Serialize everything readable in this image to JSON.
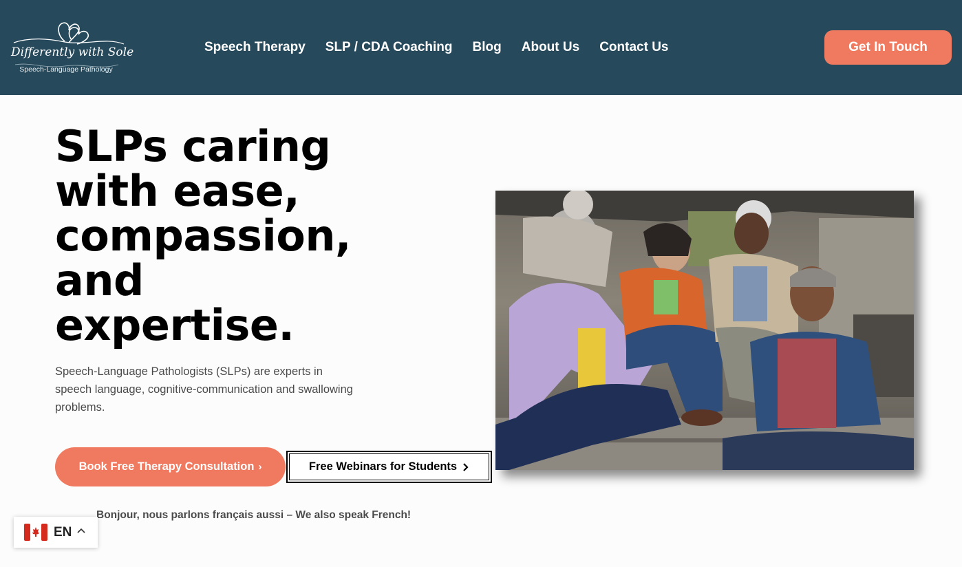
{
  "header": {
    "logo_script": "Differently with Sole",
    "logo_subtitle": "Speech-Language Pathology",
    "nav": [
      {
        "label": "Speech Therapy"
      },
      {
        "label": "SLP / CDA Coaching"
      },
      {
        "label": "Blog"
      },
      {
        "label": "About Us"
      },
      {
        "label": "Contact Us"
      }
    ],
    "cta_label": "Get In Touch"
  },
  "hero": {
    "title_lines": [
      "SLPs caring",
      "with ease,",
      "compassion,",
      "and",
      "expertise."
    ],
    "description": "Speech-Language Pathologists (SLPs) are experts in speech language, cognitive-communication and swallowing problems.",
    "primary_button": "Book Free Therapy Consultation",
    "secondary_button": "Free Webinars for Students",
    "french_note": "Bonjour, nous parlons français aussi – We also speak French!"
  },
  "language_switcher": {
    "code": "EN",
    "flag_icon": "canada-flag-icon",
    "caret_icon": "chevron-up-icon"
  },
  "colors": {
    "header_bg": "#264a5c",
    "accent": "#f07a5f",
    "text_dark": "#000000",
    "text_body": "#4a4a4a"
  }
}
